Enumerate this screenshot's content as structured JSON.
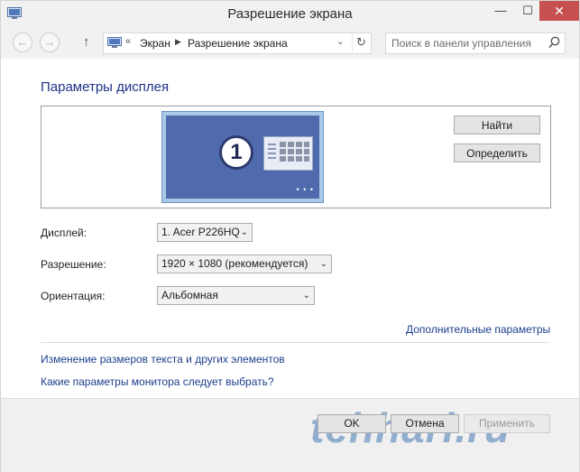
{
  "window": {
    "title": "Разрешение экрана",
    "controls": {
      "minimize": "—",
      "maximize": "☐",
      "close": "✕"
    }
  },
  "navbar": {
    "back_icon": "←",
    "forward_icon": "→",
    "up_icon": "↑",
    "address": {
      "overflow": "«",
      "crumbs": [
        "Экран",
        "Разрешение экрана"
      ],
      "separator": "▶",
      "dropdown": "⌄",
      "refresh": "↻"
    },
    "search": {
      "placeholder": "Поиск в панели управления"
    }
  },
  "main": {
    "heading": "Параметры дисплея",
    "preview": {
      "monitor_number": "1",
      "dots": "• • •"
    },
    "buttons": {
      "find": "Найти",
      "identify": "Определить"
    },
    "fields": {
      "display": {
        "label": "Дисплей:",
        "value": "1. Acer P226HQ"
      },
      "resolution": {
        "label": "Разрешение:",
        "value": "1920 × 1080 (рекомендуется)"
      },
      "orientation": {
        "label": "Ориентация:",
        "value": "Альбомная"
      }
    },
    "advanced_link": "Дополнительные параметры",
    "links": {
      "text_size": "Изменение размеров текста и других элементов",
      "monitor_help": "Какие параметры монитора следует выбрать?"
    }
  },
  "footer": {
    "ok": "OK",
    "cancel": "Отмена",
    "apply": "Применить",
    "watermark": "tehhari.ru"
  },
  "colors": {
    "accent": "#1e3287",
    "link": "#1b3e8c",
    "close": "#c75050",
    "monitor": "#506aae"
  }
}
